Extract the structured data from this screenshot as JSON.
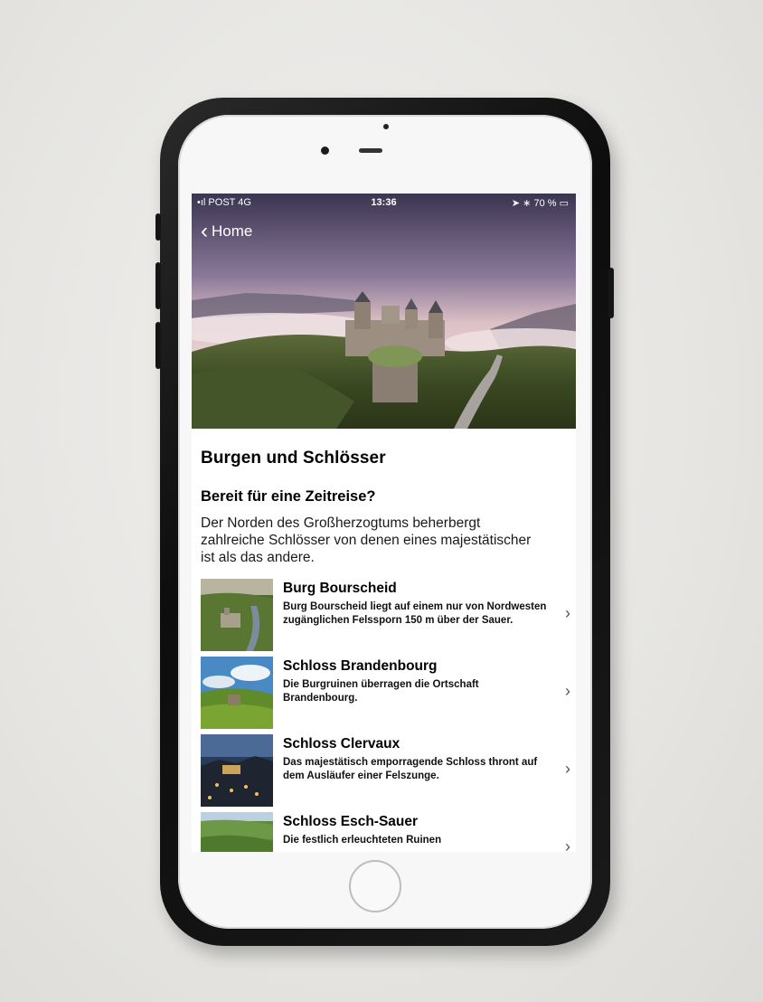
{
  "status_bar": {
    "carrier": "POST",
    "network": "4G",
    "time": "13:36",
    "battery": "70 %"
  },
  "nav": {
    "back_label": "Home"
  },
  "page": {
    "title": "Burgen und Schlösser",
    "subtitle": "Bereit für eine Zeitreise?",
    "intro": "Der Norden des Großherzogtums beherbergt zahlreiche Schlösser von denen eines majestätischer ist als das andere."
  },
  "items": [
    {
      "title": "Burg Bourscheid",
      "description": "Burg Bourscheid liegt auf einem nur von Nordwesten zugänglichen Felssporn 150 m über der Sauer."
    },
    {
      "title": "Schloss Brandenbourg",
      "description": "Die Burgruinen überragen die Ortschaft Brandenbourg."
    },
    {
      "title": "Schloss Clervaux",
      "description": "Das majestätisch emporragende Schloss thront auf dem Ausläufer einer Felszunge."
    },
    {
      "title": "Schloss Esch-Sauer",
      "description": "Die festlich erleuchteten Ruinen"
    }
  ],
  "colors": {
    "phone_case": "#111111",
    "screen_bg": "#ffffff",
    "text": "#000000"
  }
}
